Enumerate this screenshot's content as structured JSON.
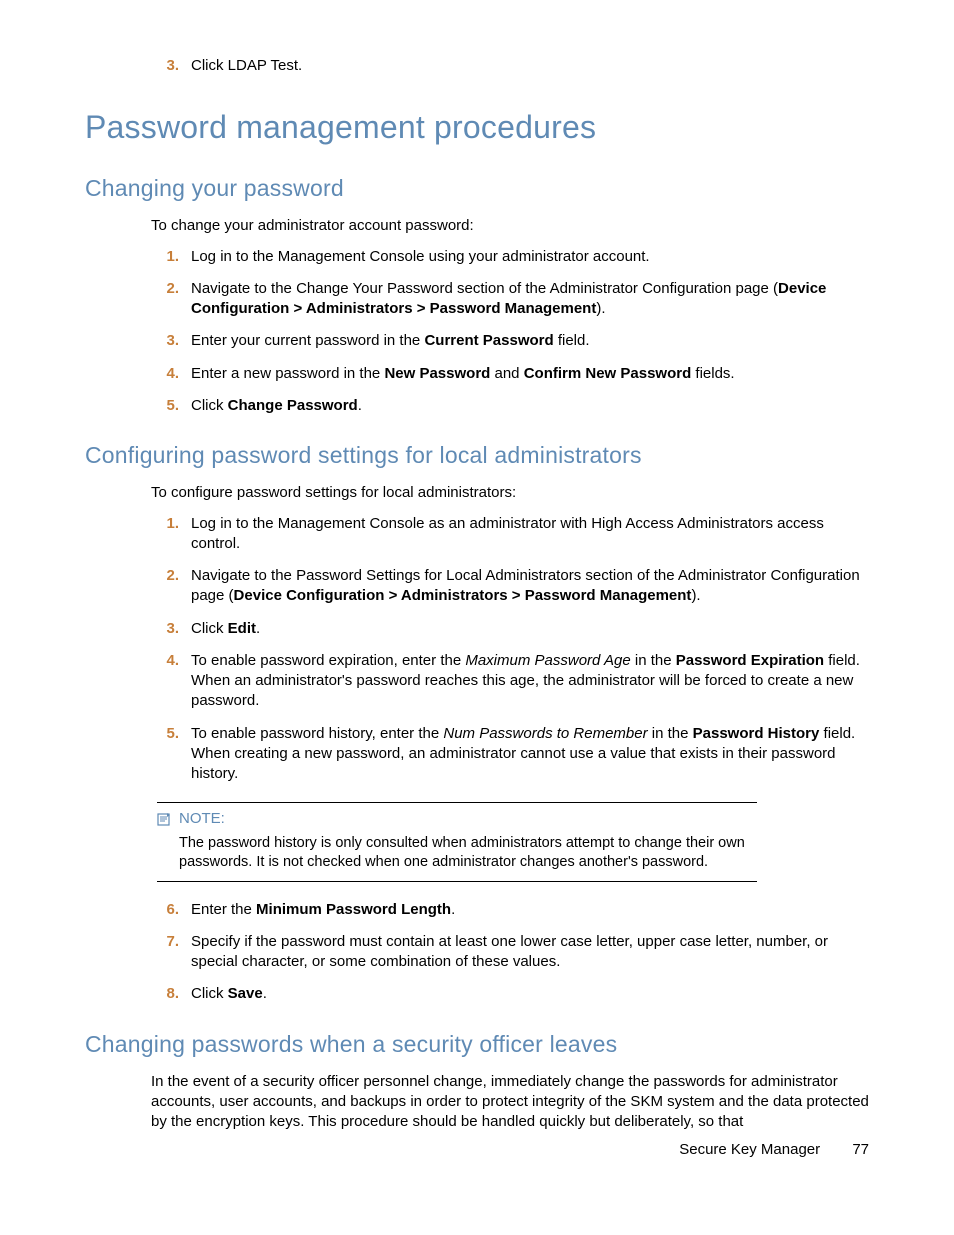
{
  "top_step": {
    "num": "3.",
    "text": "Click LDAP Test."
  },
  "h1": "Password management procedures",
  "sec1": {
    "h2": "Changing your password",
    "intro": "To change your administrator account password:",
    "steps": [
      {
        "num": "1.",
        "plain": "Log in to the Management Console using your administrator account."
      },
      {
        "num": "2.",
        "pre": "Navigate to the Change Your Password section of the Administrator Configuration page (",
        "b": "Device Configuration > Administrators > Password Management",
        "post": ")."
      },
      {
        "num": "3.",
        "pre": "Enter your current password in the ",
        "b": "Current Password",
        "post": " field."
      },
      {
        "num": "4.",
        "pre": "Enter a new password in the ",
        "b": "New Password",
        "mid": " and ",
        "b2": "Confirm New Password",
        "post": " fields."
      },
      {
        "num": "5.",
        "pre": "Click ",
        "b": "Change Password",
        "post": "."
      }
    ]
  },
  "sec2": {
    "h2": "Configuring password settings for local administrators",
    "intro": "To configure password settings for local administrators:",
    "steps_a": [
      {
        "num": "1.",
        "plain": "Log in to the Management Console as an administrator with High Access Administrators access control."
      },
      {
        "num": "2.",
        "pre": "Navigate to the Password Settings for Local Administrators section of the Administrator Configuration page (",
        "b": "Device Configuration > Administrators > Password Management",
        "post": ")."
      },
      {
        "num": "3.",
        "pre": "Click ",
        "b": "Edit",
        "post": "."
      },
      {
        "num": "4.",
        "pre": "To enable password expiration, enter the ",
        "i": "Maximum Password Age",
        "mid": " in the ",
        "b": "Password Expiration",
        "post": " field. When an administrator's password reaches this age, the administrator will be forced to create a new password."
      },
      {
        "num": "5.",
        "pre": "To enable password history, enter the ",
        "i": "Num Passwords to Remember",
        "mid": " in the ",
        "b": "Password History",
        "post": " field. When creating a new password, an administrator cannot use a value that exists in their password history."
      }
    ],
    "note_label": "NOTE:",
    "note_body": "The password history is only consulted when administrators attempt to change their own passwords. It is not checked when one administrator changes another's password.",
    "steps_b": [
      {
        "num": "6.",
        "pre": "Enter the ",
        "b": "Minimum Password Length",
        "post": "."
      },
      {
        "num": "7.",
        "plain": "Specify if the password must contain at least one lower case letter, upper case letter, number, or special character, or some combination of these values."
      },
      {
        "num": "8.",
        "pre": "Click ",
        "b": "Save",
        "post": "."
      }
    ]
  },
  "sec3": {
    "h2": "Changing passwords when a security officer leaves",
    "para": "In the event of a security officer personnel change, immediately change the passwords for administrator accounts, user accounts, and backups in order to protect integrity of the SKM system and the data protected by the encryption keys. This procedure should be handled quickly but deliberately, so that"
  },
  "footer": {
    "title": "Secure Key Manager",
    "page": "77"
  }
}
